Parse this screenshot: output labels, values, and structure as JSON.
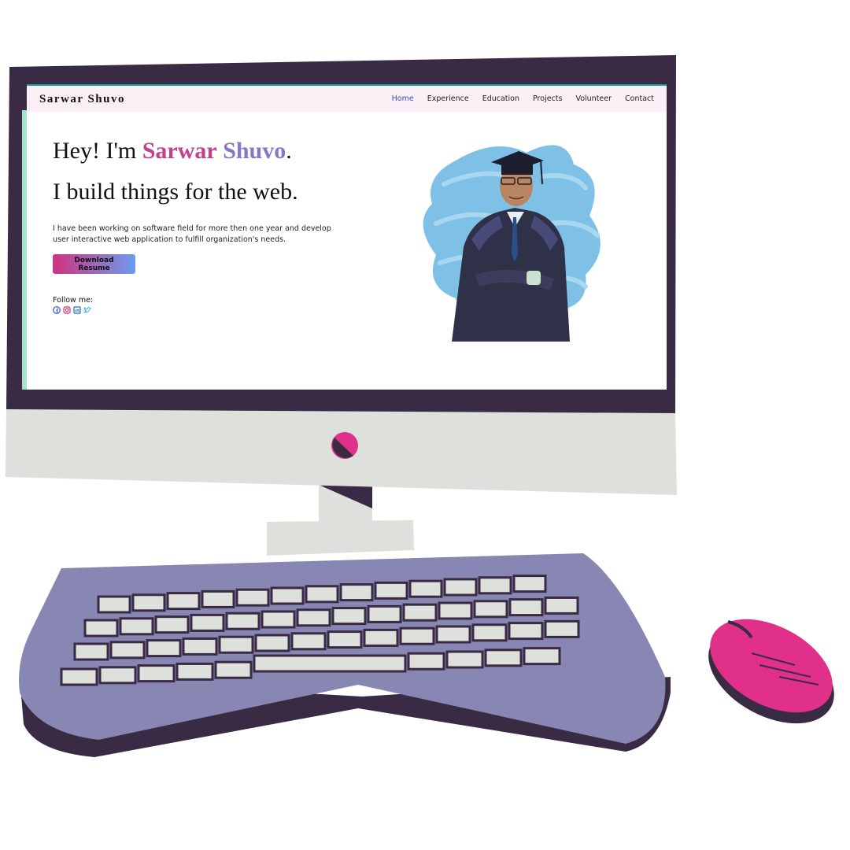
{
  "site": {
    "brand": "Sarwar Shuvo",
    "nav": [
      "Home",
      "Experience",
      "Education",
      "Projects",
      "Volunteer",
      "Contact"
    ],
    "active_nav": "Home"
  },
  "hero": {
    "greeting_prefix": "Hey! I'm ",
    "name_first": "Sarwar",
    "name_last": "Shuvo",
    "greeting_suffix": ".",
    "tagline": "I build things for the web.",
    "description": "I have been working on software field for more then one year and develop user interactive web application to fulfill organization's needs.",
    "download_button": "Download Resume",
    "follow_label": "Follow me:",
    "socials": [
      "facebook-icon",
      "instagram-icon",
      "linkedin-icon",
      "twitter-icon"
    ]
  },
  "colors": {
    "monitor_frame": "#3a2b44",
    "monitor_chin": "#dde0db",
    "keyboard": "#8886b2",
    "keys": "#dde0db",
    "mouse": "#e1308a",
    "accent_pink": "#c43f8e",
    "accent_purple": "#8478c9",
    "nav_active": "#2f4fc4"
  }
}
